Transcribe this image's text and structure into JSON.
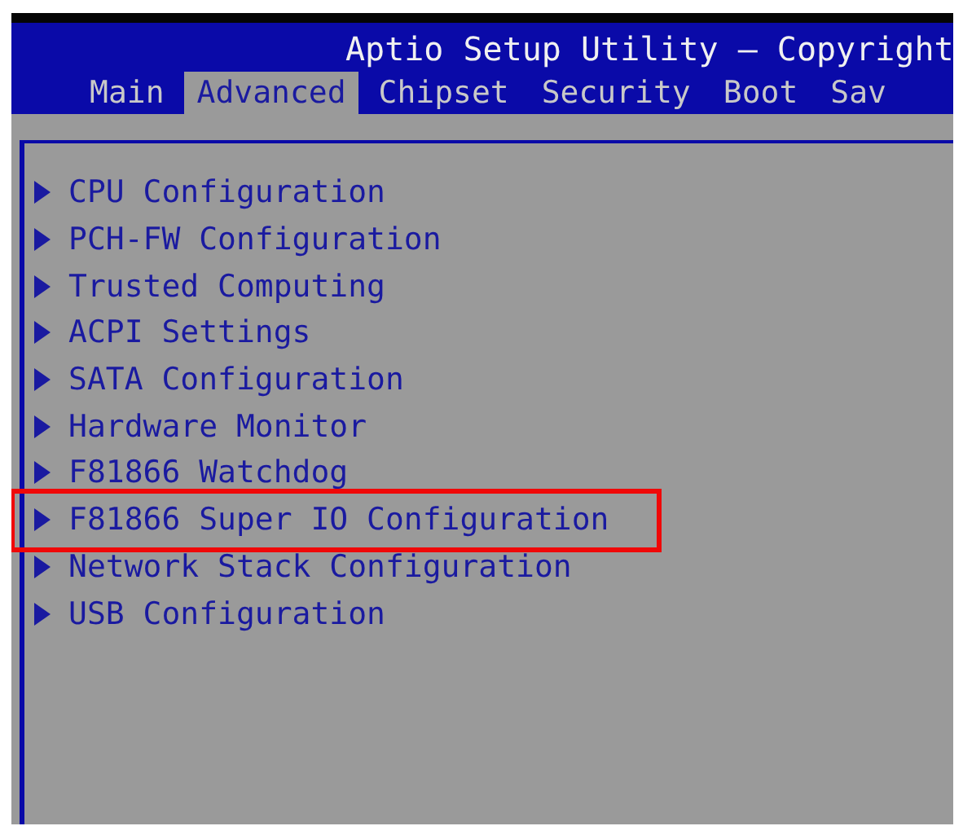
{
  "title": "Aptio Setup Utility – Copyright",
  "tabs": [
    {
      "label": "Main",
      "selected": false
    },
    {
      "label": "Advanced",
      "selected": true
    },
    {
      "label": "Chipset",
      "selected": false
    },
    {
      "label": "Security",
      "selected": false
    },
    {
      "label": "Boot",
      "selected": false
    },
    {
      "label": "Sav",
      "selected": false
    }
  ],
  "menu_items": [
    {
      "label": "CPU Configuration",
      "highlighted": false
    },
    {
      "label": "PCH-FW Configuration",
      "highlighted": false
    },
    {
      "label": "Trusted Computing",
      "highlighted": false
    },
    {
      "label": "ACPI Settings",
      "highlighted": false
    },
    {
      "label": "SATA Configuration",
      "highlighted": false
    },
    {
      "label": "Hardware Monitor",
      "highlighted": false
    },
    {
      "label": "F81866 Watchdog",
      "highlighted": false
    },
    {
      "label": "F81866 Super IO Configuration",
      "highlighted": true
    },
    {
      "label": "Network Stack Configuration",
      "highlighted": false
    },
    {
      "label": "USB Configuration",
      "highlighted": false
    }
  ]
}
